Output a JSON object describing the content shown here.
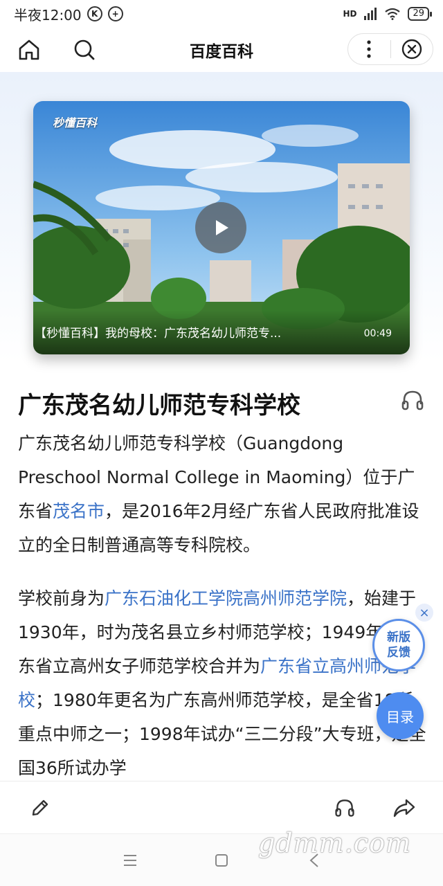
{
  "status_bar": {
    "time": "半夜12:00",
    "left_icons": [
      "k-circle-icon",
      "plus-circle-icon"
    ],
    "network": "HD",
    "battery": "29"
  },
  "nav": {
    "title": "百度百科",
    "icons": [
      "home-icon",
      "search-icon",
      "more-vertical-icon",
      "close-circle-icon"
    ]
  },
  "video": {
    "logo": "秒懂百科",
    "caption": "【秒懂百科】我的母校：广东茂名幼儿师范专...",
    "duration": "00:49"
  },
  "article": {
    "title": "广东茂名幼儿师范专科学校",
    "p1": {
      "before_link": "广东茂名幼儿师范专科学校（Guangdong Preschool Normal College in Maoming）位于广东省",
      "link": "茂名市",
      "after_link": "，是2016年2月经广东省人民政府批准设立的全日制普通高等专科院校。"
    },
    "p2": {
      "t1": "学校前身为",
      "link1": "广东石油化工学院高州师范学院",
      "t2": "，始建于1930年，时为茂名县立乡村师范学校；1949年与广东省立高州女子师范学校合并为",
      "link2": "广东省立高州师范学校",
      "t3": "；1980年更名为广东高州师范学校，是全省18所重点中师之一；1998年试办“三二分段”大专班，是全国36所试办学"
    }
  },
  "floating": {
    "feedback_line1": "新版",
    "feedback_line2": "反馈",
    "feedback_close": "×",
    "toc": "目录"
  },
  "toolbar": {
    "icons": [
      "edit-pencil-icon",
      "headphones-icon",
      "share-icon"
    ]
  },
  "watermark": "gdmm.com",
  "colors": {
    "link": "#3b73c8",
    "toc_button": "#4e8cf0",
    "feedback_border": "#5b8fe8"
  }
}
